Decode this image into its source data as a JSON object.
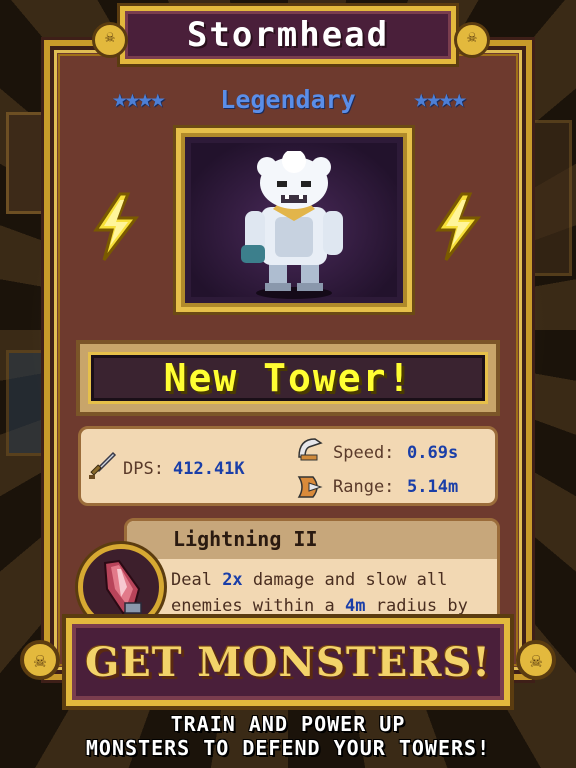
{
  "monster": {
    "name": "Stormhead",
    "rarity": "Legendary",
    "stars_left": "★★★★",
    "stars_right": "★★★★",
    "portrait_icon": "yeti-monster-icon"
  },
  "banner": {
    "label": "New Tower!"
  },
  "stats": {
    "dps_label": "DPS:",
    "dps_value": "412.41K",
    "speed_label": "Speed:",
    "speed_value": "0.69s",
    "range_label": "Range:",
    "range_value": "5.14m"
  },
  "ability": {
    "title": "Lightning II",
    "desc_1": "Deal ",
    "desc_hl_1": "2x",
    "desc_2": " damage and slow all enemies within a ",
    "desc_hl_2": "4m",
    "desc_3": " radius by",
    "icon": "crystal-claw-icon"
  },
  "promo": {
    "headline": "GET MONSTERS!",
    "tagline_1": "TRAIN AND POWER UP",
    "tagline_2": "MONSTERS TO DEFEND YOUR TOWERS!"
  },
  "colors": {
    "accent_gold": "#e3b93d",
    "rarity_blue": "#5b8ee8",
    "value_blue": "#1a3ea8",
    "banner_yellow": "#ffff33"
  }
}
